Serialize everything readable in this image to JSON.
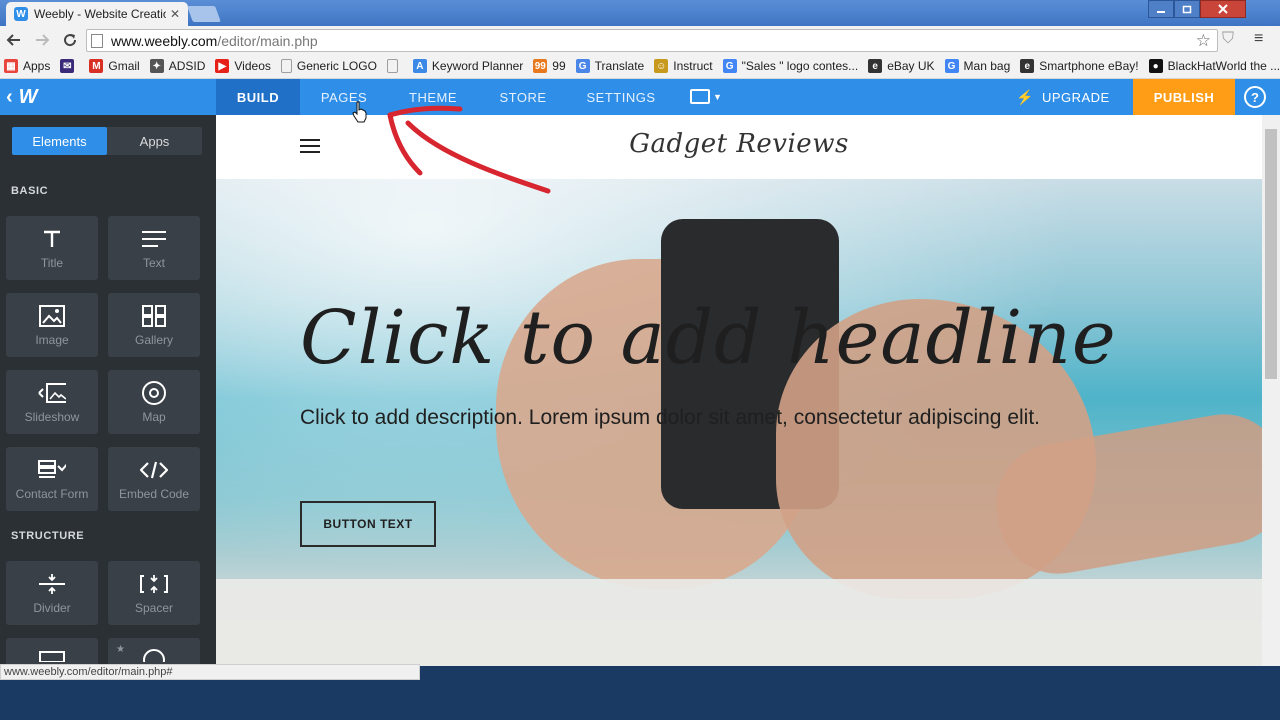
{
  "browser": {
    "tab_title": "Weebly - Website Creatio",
    "tab_close": "✕",
    "url_host": "www.weebly.com",
    "url_path": "/editor/main.php",
    "status_url": "www.weebly.com/editor/main.php#"
  },
  "bookmarks": [
    {
      "label": "Apps",
      "icon": "apps-grid-icon",
      "color": "#e8453c"
    },
    {
      "label": "",
      "icon": "mail-icon",
      "color": "#3b2a7a"
    },
    {
      "label": "Gmail",
      "icon": "gmail-icon",
      "color": "#d93025"
    },
    {
      "label": "ADSID",
      "icon": "adsid-icon",
      "color": "#555555"
    },
    {
      "label": "Videos",
      "icon": "youtube-icon",
      "color": "#e62117"
    },
    {
      "label": "Generic LOGO",
      "icon": "page-icon",
      "color": "#9e9e9e"
    },
    {
      "label": "",
      "icon": "page-icon",
      "color": "#9e9e9e"
    },
    {
      "label": "Keyword Planner",
      "icon": "adwords-icon",
      "color": "#3c8ae6"
    },
    {
      "label": "99",
      "icon": "99designs-icon",
      "color": "#e8791e"
    },
    {
      "label": "Translate",
      "icon": "translate-icon",
      "color": "#4a86e8"
    },
    {
      "label": "Instruct",
      "icon": "instruct-icon",
      "color": "#c79a1e"
    },
    {
      "label": "\"Sales \" logo contes...",
      "icon": "google-icon",
      "color": "#4285f4"
    },
    {
      "label": "eBay UK",
      "icon": "ebay-icon",
      "color": "#333333"
    },
    {
      "label": "Man bag",
      "icon": "google-icon",
      "color": "#4285f4"
    },
    {
      "label": "Smartphone eBay!",
      "icon": "ebay-icon",
      "color": "#333333"
    },
    {
      "label": "BlackHatWorld the ...",
      "icon": "blackhatworld-icon",
      "color": "#111111"
    }
  ],
  "editor": {
    "tabs": {
      "build": "BUILD",
      "pages": "PAGES",
      "theme": "THEME",
      "store": "STORE",
      "settings": "SETTINGS"
    },
    "upgrade": "UPGRADE",
    "publish": "PUBLISH",
    "help": "?",
    "logo": "W"
  },
  "sidebar": {
    "segments": {
      "elements": "Elements",
      "apps": "Apps"
    },
    "basic_label": "BASIC",
    "structure_label": "STRUCTURE",
    "basic_items": [
      {
        "label": "Title",
        "icon": "title-icon"
      },
      {
        "label": "Text",
        "icon": "text-icon"
      },
      {
        "label": "Image",
        "icon": "image-icon"
      },
      {
        "label": "Gallery",
        "icon": "gallery-icon"
      },
      {
        "label": "Slideshow",
        "icon": "slideshow-icon"
      },
      {
        "label": "Map",
        "icon": "map-icon"
      },
      {
        "label": "Contact Form",
        "icon": "contact-form-icon"
      },
      {
        "label": "Embed Code",
        "icon": "embed-code-icon"
      }
    ],
    "structure_items": [
      {
        "label": "Divider",
        "icon": "divider-icon"
      },
      {
        "label": "Spacer",
        "icon": "spacer-icon"
      }
    ]
  },
  "site": {
    "title": "Gadget Reviews",
    "headline": "Click to add headline",
    "description": "Click to add description. Lorem ipsum dolor sit amet, consectetur adipiscing elit.",
    "button_text": "BUTTON TEXT"
  },
  "colors": {
    "weebly_blue": "#2f8fe8",
    "build_active": "#2170c8",
    "publish_orange": "#ff9e16",
    "sidebar_bg": "#2b3035",
    "annotation_red": "#d7262f"
  }
}
